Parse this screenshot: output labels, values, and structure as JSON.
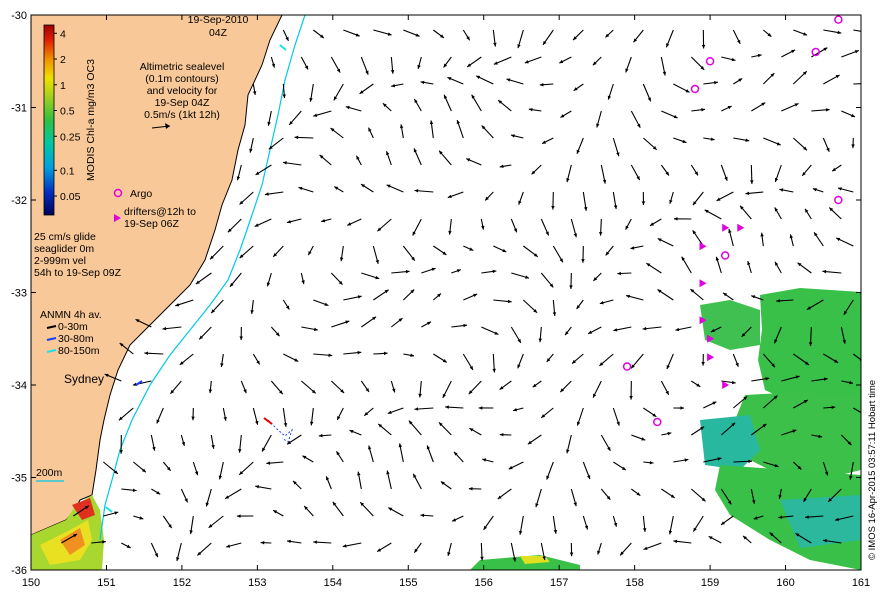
{
  "header": {
    "date": "19-Sep-2010",
    "time": "04Z"
  },
  "axes": {
    "x_ticks": [
      "150",
      "151",
      "152",
      "153",
      "154",
      "155",
      "156",
      "157",
      "158",
      "159",
      "160",
      "161"
    ],
    "y_ticks": [
      "-30",
      "-31",
      "-32",
      "-33",
      "-34",
      "-35",
      "-36"
    ],
    "x_range": [
      150,
      161
    ],
    "y_range": [
      -36,
      -30
    ]
  },
  "colorbar": {
    "title": "MODIS Chl-a mg/m3 OC3",
    "labels": [
      "4",
      "2",
      "1",
      "0.5",
      "0.25",
      "0.1",
      "0.05"
    ],
    "label_values": [
      4,
      2,
      1,
      0.5,
      0.25,
      0.1,
      0.05
    ],
    "log_scale": true,
    "colors": [
      "#00005a",
      "#0030c0",
      "#00a0e0",
      "#00c8a0",
      "#30c040",
      "#a0d020",
      "#f0e000",
      "#f09000",
      "#e02000",
      "#a00000"
    ]
  },
  "legend": {
    "altimetry": [
      "Altimetric sealevel",
      "(0.1m contours)",
      "and velocity for",
      "19-Sep 04Z",
      "0.5m/s (1kt 12h)"
    ],
    "argo": "Argo",
    "drifters": [
      "drifters@12h to",
      "19-Sep 06Z"
    ],
    "glider": [
      "25 cm/s glide",
      "seaglider 0m",
      "2-999m vel",
      "54h to 19-Sep 09Z"
    ],
    "anmn_title": "ANMN 4h av.",
    "anmn_items": [
      {
        "label": "0-30m",
        "color": "#000000"
      },
      {
        "label": "30-80m",
        "color": "#1a3cff"
      },
      {
        "label": "80-150m",
        "color": "#20e0e0"
      }
    ],
    "isobath": "200m"
  },
  "place_labels": {
    "city": "Sydney"
  },
  "credit": "© IMOS 16-Apr-2015 03:57:11 Hobart time",
  "colors": {
    "land": "#f9c898",
    "coast": "#000000",
    "shelf_contour": "#00c8e8",
    "argo": "#e000e0",
    "drifter": "#e000e0",
    "arrow": "#000000",
    "chl_green": "#30c040",
    "chl_teal": "#20c0a0"
  }
}
